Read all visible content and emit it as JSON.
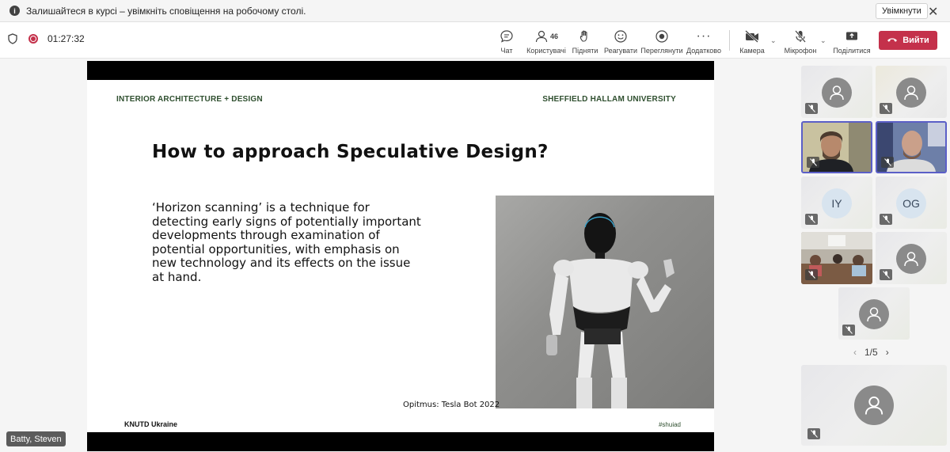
{
  "notification": {
    "text": "Залишайтеся в курсі – увімкніть сповіщення на робочому столі.",
    "enable_label": "Увімкнути",
    "close_glyph": "✕"
  },
  "toolbar": {
    "timer": "01:27:32",
    "buttons": {
      "chat": "Чат",
      "people": "Користувачі",
      "people_count": "46",
      "raise": "Підняти",
      "react": "Реагувати",
      "view": "Переглянути",
      "more": "Додатково",
      "camera": "Камера",
      "mic": "Мікрофон",
      "share": "Поділитися"
    },
    "leave_label": "Вийти"
  },
  "slide": {
    "header_left": "INTERIOR ARCHITECTURE + DESIGN",
    "header_right": "SHEFFIELD HALLAM UNIVERSITY",
    "title": "How to approach Speculative Design?",
    "body": "‘Horizon scanning’ is a technique for detecting early signs of potentially important developments through examination of potential opportunities, with emphasis on new technology and its effects on the issue at hand.",
    "caption": "Opitmus: Tesla Bot 2022",
    "footer_left": "KNUTD Ukraine",
    "footer_right": "#shuiad"
  },
  "participants": {
    "initials": [
      "IY",
      "OG"
    ],
    "pager": "1/5"
  },
  "presenter_name": "Batty, Steven",
  "colors": {
    "accent": "#5b5fc7",
    "leave": "#c4314b",
    "slide_header": "#2f4f2f"
  }
}
